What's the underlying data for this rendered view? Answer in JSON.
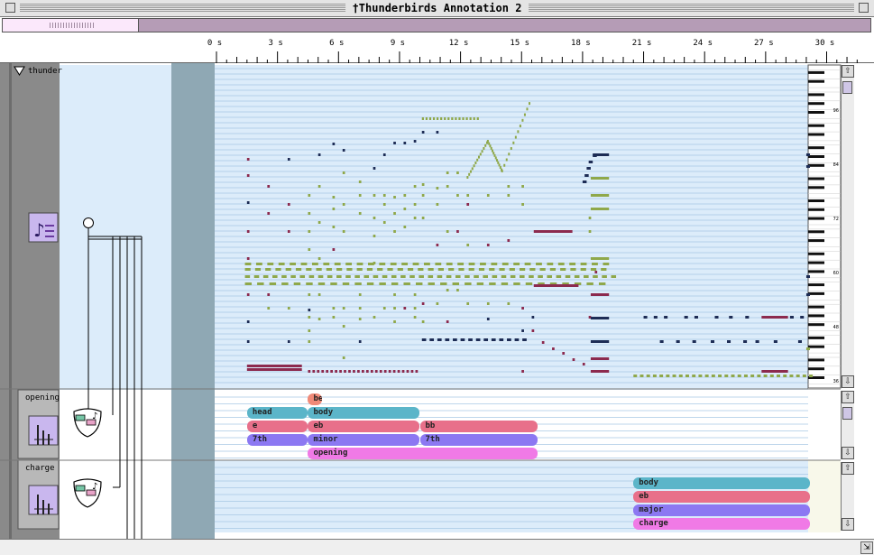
{
  "window": {
    "title": "†Thunderbirds Annotation 2"
  },
  "timeline": {
    "ticks": [
      "0 s",
      "3 s",
      "6 s",
      "9 s",
      "12 s",
      "15 s",
      "18 s",
      "21 s",
      "24 s",
      "27 s",
      "30 s"
    ]
  },
  "tracks": {
    "piano_roll": {
      "name": "thunder",
      "octave_labels": [
        "96",
        "84",
        "72",
        "60",
        "48",
        "36"
      ]
    },
    "opening": {
      "name": "opening",
      "annotations": [
        {
          "text": "be",
          "row": 0,
          "start": 4.5,
          "end": 5.2,
          "color": "#f08a78"
        },
        {
          "text": "head",
          "row": 1,
          "start": 1.5,
          "end": 4.5,
          "color": "#5bb5c9"
        },
        {
          "text": "body",
          "row": 1,
          "start": 4.5,
          "end": 10.0,
          "color": "#5bb5c9"
        },
        {
          "text": "e",
          "row": 2,
          "start": 1.5,
          "end": 4.5,
          "color": "#e8708a"
        },
        {
          "text": "eb",
          "row": 2,
          "start": 4.5,
          "end": 10.0,
          "color": "#e8708a"
        },
        {
          "text": "bb",
          "row": 2,
          "start": 10.0,
          "end": 15.8,
          "color": "#e8708a"
        },
        {
          "text": "7th",
          "row": 3,
          "start": 1.5,
          "end": 4.5,
          "color": "#8c78f2"
        },
        {
          "text": "minor",
          "row": 3,
          "start": 4.5,
          "end": 10.0,
          "color": "#8c78f2"
        },
        {
          "text": "7th",
          "row": 3,
          "start": 10.0,
          "end": 15.8,
          "color": "#8c78f2"
        },
        {
          "text": "opening",
          "row": 4,
          "start": 4.5,
          "end": 15.8,
          "color": "#f07ae6"
        }
      ]
    },
    "charge": {
      "name": "charge",
      "annotations": [
        {
          "text": "body",
          "row": 0,
          "start": 20.5,
          "end": 29.2,
          "color": "#5bb5c9"
        },
        {
          "text": "eb",
          "row": 1,
          "start": 20.5,
          "end": 29.2,
          "color": "#e8708a"
        },
        {
          "text": "major",
          "row": 2,
          "start": 20.5,
          "end": 29.2,
          "color": "#8c78f2"
        },
        {
          "text": "charge",
          "row": 3,
          "start": 20.5,
          "end": 29.2,
          "color": "#f07ae6"
        }
      ]
    }
  },
  "colors": {
    "note_green": "#8fa84a",
    "note_navy": "#1d2c55",
    "note_maroon": "#8c2a4e",
    "track_bg": "#dcecfa",
    "sidebar": "#8a8a8a",
    "gutter": "#8fa8b4"
  }
}
